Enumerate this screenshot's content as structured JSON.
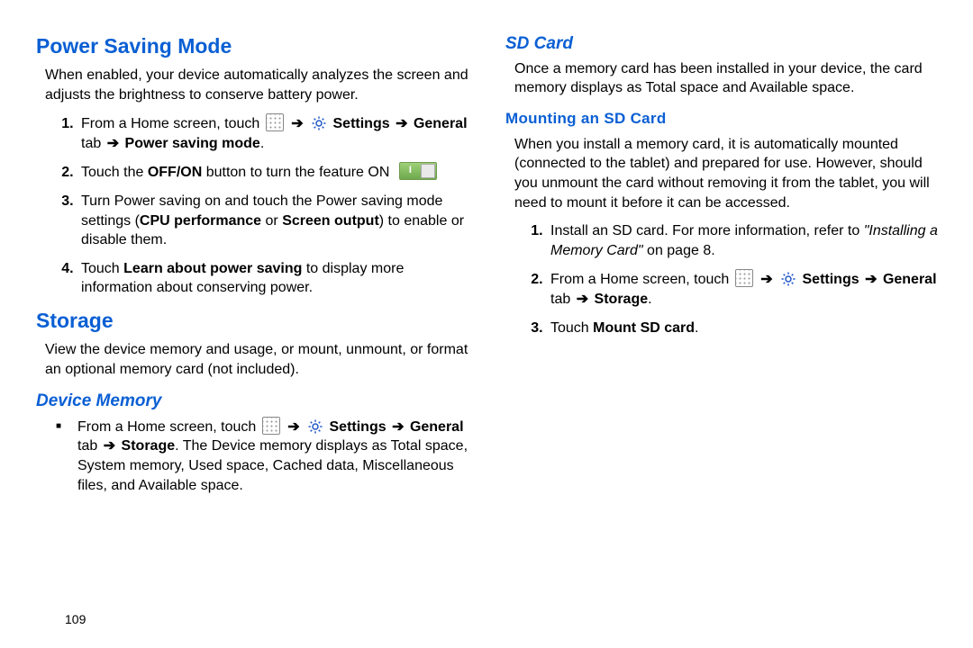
{
  "page_number": "109",
  "left": {
    "powerSaving": {
      "heading": "Power Saving Mode",
      "intro": "When enabled, your device automatically analyzes the screen and adjusts the brightness to conserve battery power.",
      "step1_a": "From a Home screen, touch ",
      "settings_word": " Settings",
      "general_tab": "General",
      "psm_word": "Power saving mode",
      "tab_word": " tab ",
      "step2_a": "Touch the ",
      "offon": "OFF/ON",
      "step2_b": " button to turn the feature ON ",
      "step3_a": "Turn Power saving on and touch the Power saving mode settings (",
      "cpu": "CPU performance",
      "or": " or ",
      "screen_output": "Screen output",
      "step3_b": ") to enable or disable them.",
      "step4_a": "Touch ",
      "learn": "Learn about power saving",
      "step4_b": " to display more information about conserving power."
    },
    "storage": {
      "heading": "Storage",
      "intro": "View the device memory and usage, or mount, unmount, or format an optional memory card (not included).",
      "devmem_heading": "Device Memory",
      "bullet_a": "From a Home screen, touch ",
      "storage_word": "Storage",
      "bullet_b": ". The Device memory displays as Total space, System memory, Used space, Cached data, Miscellaneous files, and Available space."
    }
  },
  "right": {
    "sdcard": {
      "heading": "SD Card",
      "intro": "Once a memory card has been installed in your device, the card memory displays as Total space and Available space.",
      "mount_heading": "Mounting an SD Card",
      "mount_intro": "When you install a memory card, it is automatically mounted (connected to the tablet) and prepared for use. However, should you unmount the card without removing it from the tablet, you will need to mount it before it can be accessed.",
      "step1_a": "Install an SD card. For more information, refer to ",
      "step1_ref": "\"Installing a Memory Card\"",
      "step1_b": " on page 8.",
      "step2_a": "From a Home screen, touch ",
      "step3_a": "Touch ",
      "mount_sd": "Mount SD card",
      "step3_b": "."
    }
  },
  "common": {
    "arrow": "➔",
    "settings": " Settings",
    "general": "General",
    "tab": " tab ",
    "storage": "Storage",
    "period": "."
  }
}
